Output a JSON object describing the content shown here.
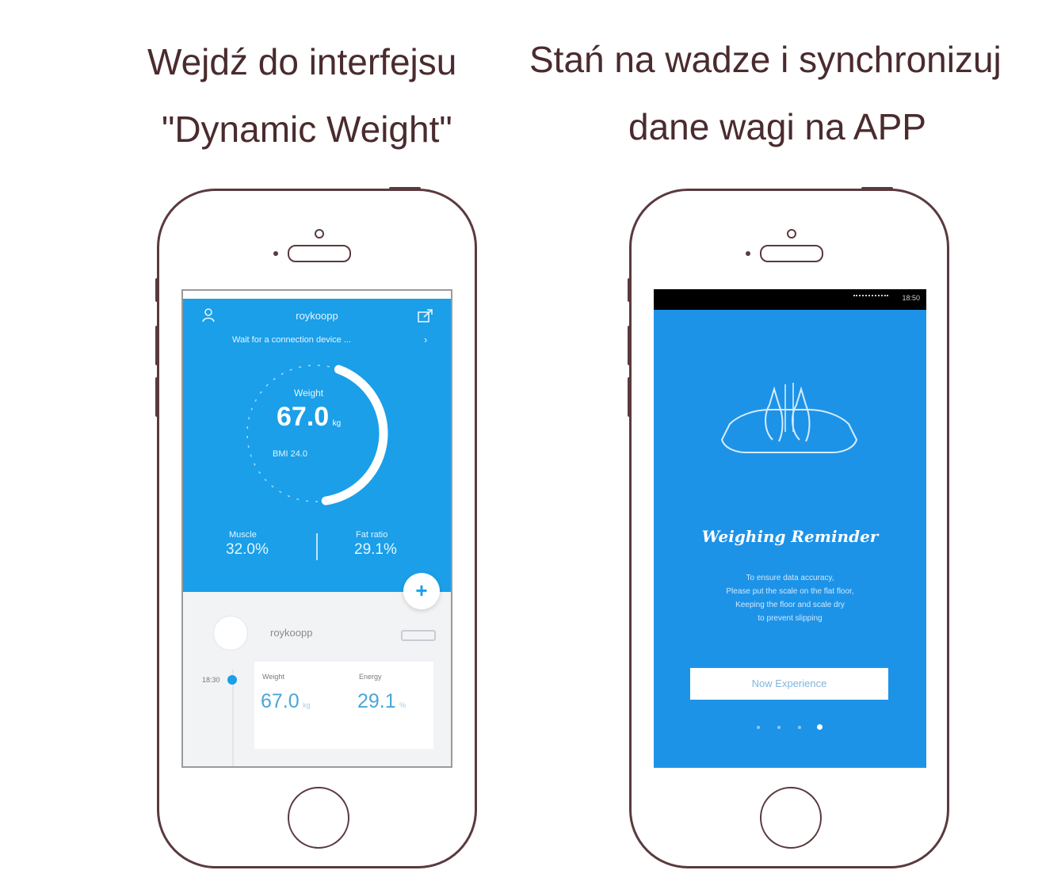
{
  "captions": {
    "left_line1": "Wejdź do interfejsu",
    "left_line2": "\"Dynamic Weight\"",
    "right_line1": "Stań na wadze i synchronizuj",
    "right_line2": "dane wagi na APP"
  },
  "phone1": {
    "header": {
      "profile_icon": "user-icon",
      "title": "roykoopp",
      "share_icon": "share-icon",
      "connection_status": "Wait for a connection device ..."
    },
    "gauge": {
      "label": "Weight",
      "value": "67.0",
      "unit": "kg",
      "bmi": "BMI 24.0",
      "progress": 0.42
    },
    "stats": [
      {
        "label": "Muscle",
        "value": "32.0%"
      },
      {
        "label": "Fat ratio",
        "value": "29.1%"
      }
    ],
    "add_button": "+",
    "user": {
      "name": "roykoopp"
    },
    "record": {
      "time": "18:30",
      "weight_label": "Weight",
      "weight_value": "67.0",
      "weight_unit": "kg",
      "second_label": "Energy",
      "second_value": "29.1",
      "second_unit": "%"
    },
    "colors": {
      "accent": "#1a9fe8",
      "value_text": "#4aa6d8"
    }
  },
  "phone2": {
    "status_bar": "18:50",
    "scale_icon": "scale-feet-icon",
    "title": "Weighing Reminder",
    "description": [
      "To ensure data accuracy,",
      "Please put the scale on the flat floor,",
      "Keeping the floor and scale dry",
      "to prevent slipping"
    ],
    "button": "Now Experience",
    "pager": {
      "count": 4,
      "active": 4
    },
    "colors": {
      "background": "#1d93e8"
    }
  }
}
